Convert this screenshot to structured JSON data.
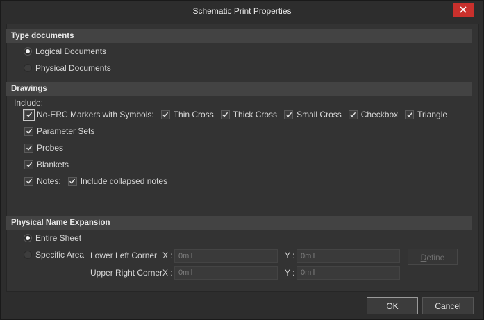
{
  "window": {
    "title": "Schematic Print Properties"
  },
  "type_documents": {
    "heading": "Type documents",
    "options": [
      "Logical Documents",
      "Physical Documents"
    ],
    "selected": "Logical Documents"
  },
  "drawings": {
    "heading": "Drawings",
    "include_label": "Include:",
    "markers_label": "No-ERC Markers with Symbols:",
    "symbols": [
      "Thin Cross",
      "Thick Cross",
      "Small Cross",
      "Checkbox",
      "Triangle"
    ],
    "parameter_sets": "Parameter Sets",
    "probes": "Probes",
    "blankets": "Blankets",
    "notes": "Notes:",
    "include_collapsed_notes": "Include collapsed notes",
    "all_checked": true
  },
  "expansion": {
    "heading": "Physical Name Expansion",
    "entire_sheet": "Entire Sheet",
    "specific_area": "Specific Area",
    "selected": "Entire Sheet",
    "lower_left_label": "Lower Left Corner",
    "upper_right_label": "Upper Right Corner",
    "x_label": "X :",
    "y_label": "Y :",
    "lower_left_x": "0mil",
    "lower_left_y": "0mil",
    "upper_right_x": "0mil",
    "upper_right_y": "0mil",
    "define_label": "Define",
    "define_mnemonic": "D",
    "define_rest": "efine"
  },
  "buttons": {
    "ok": "OK",
    "cancel": "Cancel"
  },
  "colors": {
    "close_button": "#c9302c",
    "background": "#2d2d2d",
    "section_header": "#434343"
  }
}
